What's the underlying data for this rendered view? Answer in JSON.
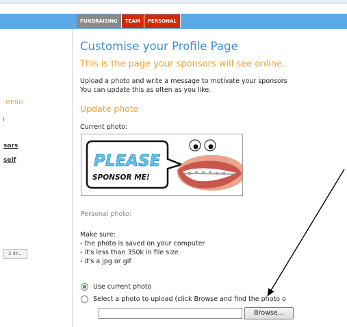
{
  "tabs": [
    {
      "label": "FUNDRAISING"
    },
    {
      "label": "TEAM"
    },
    {
      "label": "PERSONAL"
    }
  ],
  "sidebar": {
    "menu_label": "MENU",
    "stray_char": "i",
    "links": [
      {
        "label": "sors"
      },
      {
        "label": "self"
      }
    ],
    "lang_badge": "2 4r..."
  },
  "main": {
    "title": "Customise your Profile Page",
    "subtitle": "This is the page your sponsors will see online.",
    "intro_line1": "Upload a photo and write a message to motivate your sponsors",
    "intro_line2": "You can update this as often as you like.",
    "update_photo_heading": "Update photo",
    "current_photo_label": "Current photo:",
    "photo": {
      "text_please": "PLEASE",
      "text_sponsor": "SPONSOR ME!"
    },
    "personal_photo_label": "Personal photo:",
    "make_sure": {
      "heading": "Make sure:",
      "items": [
        "- the photo is saved on your computer",
        "- it's less than 350k in file size",
        "- it's a jpg or gif"
      ]
    },
    "options": {
      "use_current": "Use current photo",
      "select_upload": "Select a photo to upload (click Browse and find the photo o"
    },
    "file_input_value": "",
    "browse_label": "Browse..."
  },
  "colors": {
    "banner": "#5aa9e6",
    "tab_grey": "#8a8a8a",
    "tab_red": "#d22a05",
    "title_blue": "#3b8ed4",
    "heading_orange": "#f0a12b"
  }
}
